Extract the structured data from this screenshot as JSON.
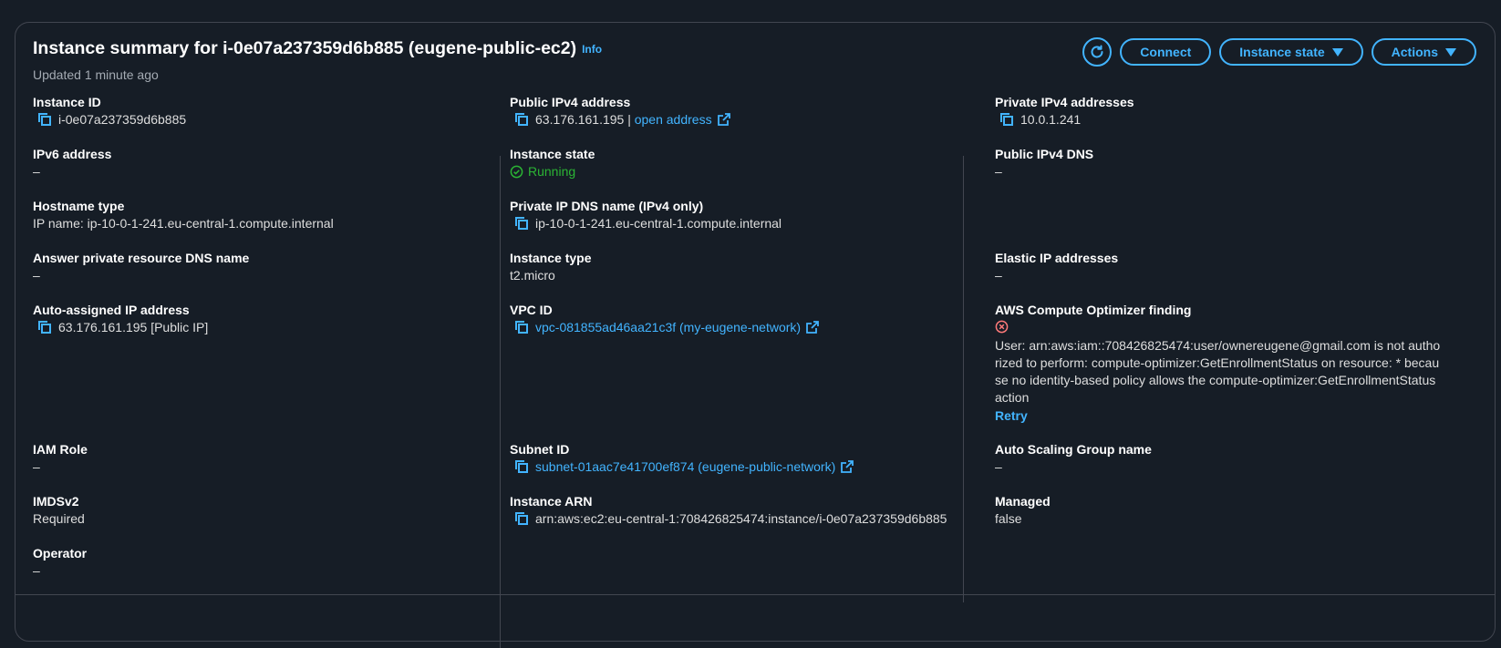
{
  "header": {
    "title": "Instance summary for i-0e07a237359d6b885 (eugene-public-ec2)",
    "info": "Info",
    "updated": "Updated 1 minute ago",
    "connect": "Connect",
    "instance_state": "Instance state",
    "actions": "Actions"
  },
  "col1": {
    "instance_id": {
      "label": "Instance ID",
      "value": "i-0e07a237359d6b885"
    },
    "ipv6": {
      "label": "IPv6 address",
      "value": "–"
    },
    "hostname_type": {
      "label": "Hostname type",
      "value": "IP name: ip-10-0-1-241.eu-central-1.compute.internal"
    },
    "answer_dns": {
      "label": "Answer private resource DNS name",
      "value": "–"
    },
    "auto_ip": {
      "label": "Auto-assigned IP address",
      "value": "63.176.161.195 [Public IP]"
    },
    "iam_role": {
      "label": "IAM Role",
      "value": "–"
    },
    "imdsv2": {
      "label": "IMDSv2",
      "value": "Required"
    },
    "operator": {
      "label": "Operator",
      "value": "–"
    }
  },
  "col2": {
    "public_ipv4": {
      "label": "Public IPv4 address",
      "value": "63.176.161.195 |",
      "link": "open address"
    },
    "instance_state": {
      "label": "Instance state",
      "value": "Running"
    },
    "private_dns": {
      "label": "Private IP DNS name (IPv4 only)",
      "value": "ip-10-0-1-241.eu-central-1.compute.internal"
    },
    "instance_type": {
      "label": "Instance type",
      "value": "t2.micro"
    },
    "vpc_id": {
      "label": "VPC ID",
      "value": "vpc-081855ad46aa21c3f (my-eugene-network)"
    },
    "subnet_id": {
      "label": "Subnet ID",
      "value": "subnet-01aac7e41700ef874 (eugene-public-network)"
    },
    "instance_arn": {
      "label": "Instance ARN",
      "value": "arn:aws:ec2:eu-central-1:708426825474:instance/i-0e07a237359d6b885"
    }
  },
  "col3": {
    "private_ipv4": {
      "label": "Private IPv4 addresses",
      "value": "10.0.1.241"
    },
    "public_dns": {
      "label": "Public IPv4 DNS",
      "value": "–"
    },
    "elastic_ip": {
      "label": "Elastic IP addresses",
      "value": "–"
    },
    "optimizer": {
      "label": "AWS Compute Optimizer finding",
      "error": "User: arn:aws:iam::708426825474:user/ownereugene@gmail.com is not authorized to perform: compute-optimizer:GetEnrollmentStatus on resource: * because no identity-based policy allows the compute-optimizer:GetEnrollmentStatus action",
      "retry": "Retry"
    },
    "asg": {
      "label": "Auto Scaling Group name",
      "value": "–"
    },
    "managed": {
      "label": "Managed",
      "value": "false"
    }
  },
  "colors": {
    "background": "#161d26",
    "link": "#42b4ff",
    "running": "#2bb534",
    "error": "#ff7a7a",
    "border": "#424650"
  }
}
